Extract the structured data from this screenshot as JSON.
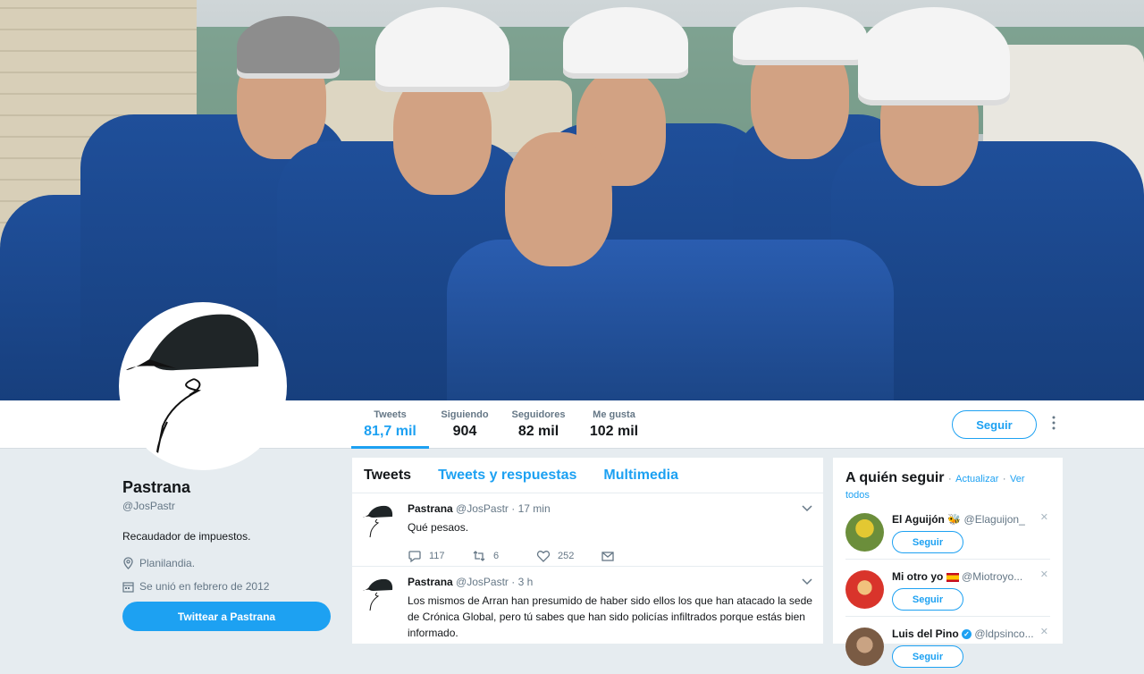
{
  "header_image": {
    "description": "workers-in-blue-coveralls-photo"
  },
  "nav": {
    "stats": [
      {
        "label": "Tweets",
        "value": "81,7 mil",
        "active": true
      },
      {
        "label": "Siguiendo",
        "value": "904"
      },
      {
        "label": "Seguidores",
        "value": "82 mil"
      },
      {
        "label": "Me gusta",
        "value": "102 mil"
      }
    ],
    "follow_label": "Seguir",
    "more_icon": "more-vertical-icon"
  },
  "profile": {
    "name": "Pastrana",
    "handle": "@JosPastr",
    "bio": "Recaudador de impuestos.",
    "location": "Planilandia.",
    "joined": "Se unió en febrero de 2012",
    "tweet_to_label": "Twittear a Pastrana"
  },
  "timeline": {
    "tabs": [
      "Tweets",
      "Tweets y respuestas",
      "Multimedia"
    ],
    "tweets": [
      {
        "name": "Pastrana",
        "handle": "@JosPastr",
        "time": "· 17 min",
        "text": "Qué pesaos.",
        "replies": "117",
        "retweets": "6",
        "likes": "252"
      },
      {
        "name": "Pastrana",
        "handle": "@JosPastr",
        "time": "· 3 h",
        "text": "Los mismos de Arran han presumido de haber sido ellos los que han atacado la sede de Crónica Global, pero tú sabes que han sido policías infiltrados porque estás bien informado."
      }
    ]
  },
  "who_to_follow": {
    "title": "A quién seguir",
    "refresh": "Actualizar",
    "view_all": "Ver todos",
    "separator": "·",
    "follow_label": "Seguir",
    "suggestions": [
      {
        "name": "El Aguijón",
        "handle": "@Elaguijon_",
        "avatar_color": "#6b8e3b"
      },
      {
        "name": "Mi otro yo",
        "handle": "@Miotroyo...",
        "avatar_color": "#d9342b"
      },
      {
        "name": "Luis del Pino",
        "handle": "@ldpsinco...",
        "avatar_color": "#7a5b44"
      }
    ]
  },
  "colors": {
    "accent": "#1da1f2",
    "background": "#e6ecf0"
  }
}
